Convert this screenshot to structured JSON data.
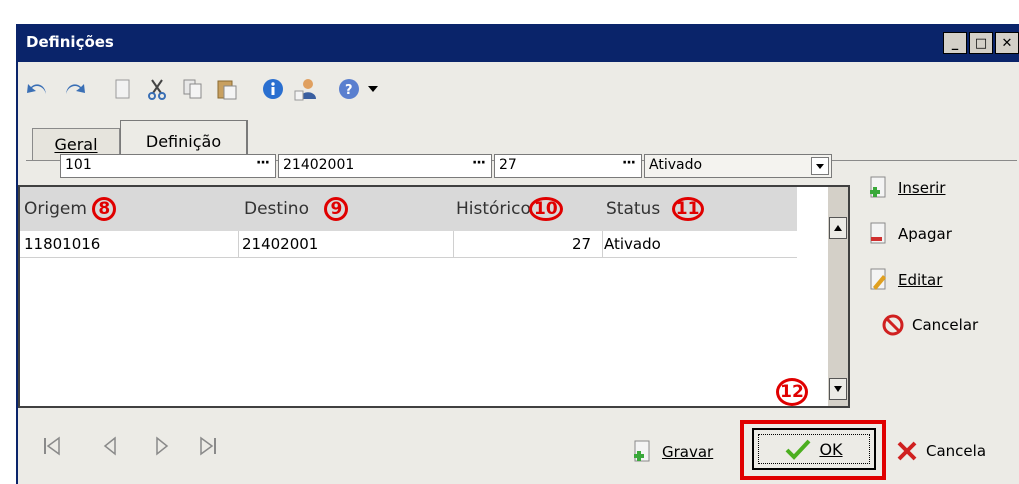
{
  "window": {
    "title": "Definições",
    "controls": [
      "_",
      "□",
      "✕"
    ]
  },
  "toolbar": {
    "icons": [
      "undo-icon",
      "redo-icon",
      "new-document-icon",
      "cut-icon",
      "copy-icon",
      "paste-icon",
      "info-icon",
      "user-icon",
      "help-icon",
      "dropdown-arrow-icon"
    ]
  },
  "tabs": [
    {
      "label": "Geral"
    },
    {
      "label": "Definição",
      "active": true
    }
  ],
  "filters": {
    "origem": "101",
    "destino": "21402001",
    "historico": "27",
    "status": "Ativado",
    "ellipsis": "···"
  },
  "grid": {
    "columns": [
      {
        "label": "Origem",
        "marker": "8"
      },
      {
        "label": "Destino",
        "marker": "9"
      },
      {
        "label": "Histórico",
        "marker": "10"
      },
      {
        "label": "Status",
        "marker": "11"
      }
    ],
    "rows": [
      {
        "origem": "11801016",
        "destino": "21402001",
        "historico": "27",
        "status": "Ativado"
      }
    ]
  },
  "side_actions": {
    "inserir": "Inserir",
    "apagar": "Apagar",
    "editar": "Editar",
    "cancelar": "Cancelar"
  },
  "bottom": {
    "gravar": "Gravar",
    "ok": "OK",
    "cancela": "Cancela",
    "ok_marker": "12"
  },
  "colors": {
    "titlebar": "#0a246a",
    "highlight": "#e00000",
    "window_bg": "#ecebe6"
  }
}
